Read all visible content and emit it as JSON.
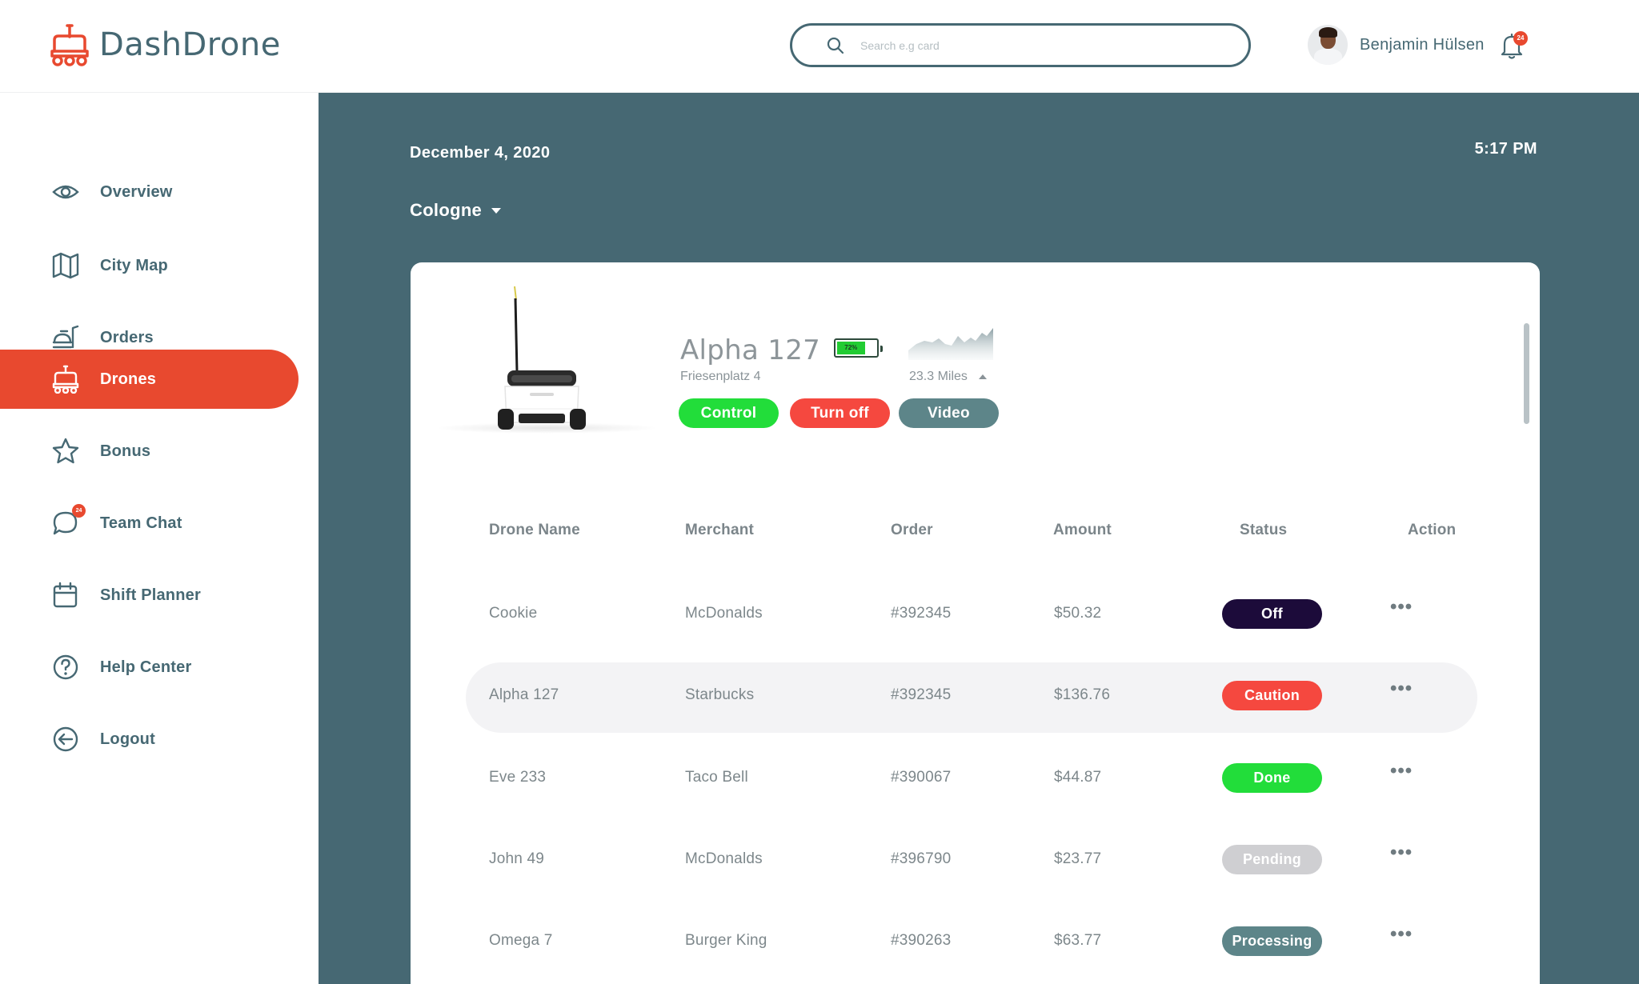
{
  "app": {
    "name": "DashDrone"
  },
  "header": {
    "search_placeholder": "Search e.g card",
    "user_name": "Benjamin Hülsen",
    "notifications_count": "24"
  },
  "sidebar": {
    "items": [
      {
        "label": "Overview",
        "icon": "eye-icon"
      },
      {
        "label": "City Map",
        "icon": "map-icon"
      },
      {
        "label": "Orders",
        "icon": "orders-icon"
      },
      {
        "label": "Drones",
        "icon": "drone-icon",
        "active": true
      },
      {
        "label": "Bonus",
        "icon": "star-icon"
      },
      {
        "label": "Team Chat",
        "icon": "chat-icon",
        "badge": "24"
      },
      {
        "label": "Shift Planner",
        "icon": "calendar-icon"
      },
      {
        "label": "Help Center",
        "icon": "help-icon"
      },
      {
        "label": "Logout",
        "icon": "logout-icon"
      }
    ]
  },
  "main": {
    "date": "December 4, 2020",
    "time": "5:17 PM",
    "city": "Cologne"
  },
  "drone": {
    "name": "Alpha 127",
    "address": "Friesenplatz 4",
    "battery_percent": 72,
    "battery_label": "72%",
    "miles": "23.3 Miles",
    "buttons": {
      "control": "Control",
      "turn_off": "Turn off",
      "video": "Video"
    }
  },
  "table": {
    "headers": [
      "Drone Name",
      "Merchant",
      "Order",
      "Amount",
      "Status",
      "Action"
    ],
    "rows": [
      {
        "drone": "Cookie",
        "merchant": "McDonalds",
        "order": "#392345",
        "amount": "$50.32",
        "status": "Off",
        "status_color": "#1c0b3a"
      },
      {
        "drone": "Alpha 127",
        "merchant": "Starbucks",
        "order": "#392345",
        "amount": "$136.76",
        "status": "Caution",
        "status_color": "#f5483f",
        "highlighted": true
      },
      {
        "drone": "Eve 233",
        "merchant": "Taco Bell",
        "order": "#390067",
        "amount": "$44.87",
        "status": "Done",
        "status_color": "#22dd3a"
      },
      {
        "drone": "John 49",
        "merchant": "McDonalds",
        "order": "#396790",
        "amount": "$23.77",
        "status": "Pending",
        "status_color": "#cfcfd2"
      },
      {
        "drone": "Omega 7",
        "merchant": "Burger King",
        "order": "#390263",
        "amount": "$63.77",
        "status": "Processing",
        "status_color": "#5d8589"
      }
    ],
    "action_glyph": "•••"
  },
  "colors": {
    "accent": "#e8492f",
    "primary": "#466873",
    "success": "#22dd3a",
    "danger": "#f5483f",
    "off": "#1c0b3a",
    "pending": "#cfcfd2",
    "processing": "#5d8589"
  }
}
